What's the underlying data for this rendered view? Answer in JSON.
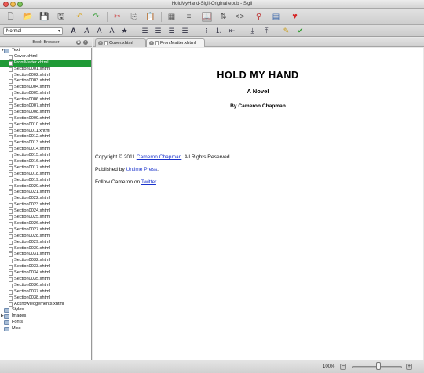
{
  "window": {
    "title": "HoldMyHand-Sigil-Original.epub - Sigil"
  },
  "toolbar": {
    "icons": [
      "new-file-icon",
      "open-icon",
      "save-icon",
      "save-as-icon",
      "undo-icon",
      "redo-icon",
      "cut-icon",
      "copy-icon",
      "paste-icon",
      "book-view-icon",
      "split-view-icon",
      "code-view-icon",
      "find-icon",
      "toc-icon",
      "donate-heart-icon"
    ],
    "accent_color": "#d6292a"
  },
  "format_bar": {
    "style_value": "Normal"
  },
  "book_browser": {
    "title": "Book Browser",
    "folders": [
      {
        "name": "Text",
        "expanded": true
      },
      {
        "name": "Styles"
      },
      {
        "name": "Images"
      },
      {
        "name": "Fonts"
      },
      {
        "name": "Misc"
      }
    ],
    "files": [
      "Cover.xhtml",
      "FrontMatter.xhtml",
      "Section0001.xhtml",
      "Section0002.xhtml",
      "Section0003.xhtml",
      "Section0004.xhtml",
      "Section0005.xhtml",
      "Section0006.xhtml",
      "Section0007.xhtml",
      "Section0008.xhtml",
      "Section0009.xhtml",
      "Section0010.xhtml",
      "Section0011.xhtml",
      "Section0012.xhtml",
      "Section0013.xhtml",
      "Section0014.xhtml",
      "Section0015.xhtml",
      "Section0016.xhtml",
      "Section0017.xhtml",
      "Section0018.xhtml",
      "Section0019.xhtml",
      "Section0020.xhtml",
      "Section0021.xhtml",
      "Section0022.xhtml",
      "Section0023.xhtml",
      "Section0024.xhtml",
      "Section0025.xhtml",
      "Section0026.xhtml",
      "Section0027.xhtml",
      "Section0028.xhtml",
      "Section0029.xhtml",
      "Section0030.xhtml",
      "Section0031.xhtml",
      "Section0032.xhtml",
      "Section0033.xhtml",
      "Section0034.xhtml",
      "Section0035.xhtml",
      "Section0036.xhtml",
      "Section0037.xhtml",
      "Section0038.xhtml",
      "Acknowledgements.xhtml"
    ],
    "selected_index": 1,
    "selection_color": "#1f9a36"
  },
  "tabs": [
    {
      "label": "Cover.xhtml",
      "active": false
    },
    {
      "label": "FrontMatter.xhtml",
      "active": true
    }
  ],
  "document": {
    "title": "HOLD MY HAND",
    "subtitle": "A Novel",
    "byline": "By Cameron Chapman",
    "copyright_prefix": "Copyright © 2011 ",
    "copyright_link": "Cameron Chapman",
    "copyright_suffix": ". All Rights Reserved.",
    "published_prefix": "Published by ",
    "published_link": "Untime Press",
    "published_suffix": ".",
    "follow_prefix": "Follow Cameron on ",
    "follow_link": "Twitter",
    "follow_suffix": "."
  },
  "status": {
    "zoom": "100%",
    "zoom_level": 0.5
  }
}
